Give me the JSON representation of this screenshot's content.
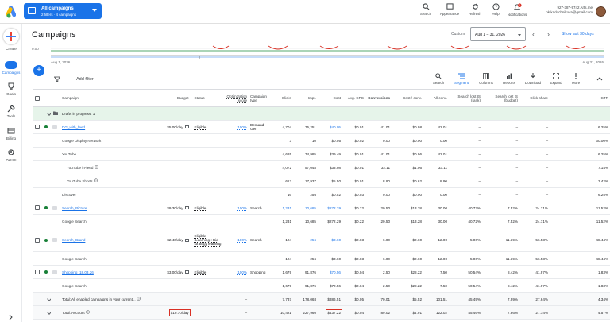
{
  "header": {
    "campaign_selector": {
      "title": "All campaigns",
      "subtitle": "2 filters · 4 campaigns"
    },
    "tools": [
      {
        "label": "Search",
        "icon": "search-icon"
      },
      {
        "label": "Appearance",
        "icon": "appearance-icon"
      },
      {
        "label": "Refresh",
        "icon": "refresh-icon"
      },
      {
        "label": "Help",
        "icon": "help-icon"
      },
      {
        "label": "Notifications",
        "icon": "bell-icon",
        "badge": "1"
      }
    ],
    "account_line1": "927-387-9742 Arts.me",
    "account_line2": "ok.kadochnikova@gmail.com"
  },
  "rail": [
    {
      "label": "Create",
      "icon": "plus-icon"
    },
    {
      "label": "Campaigns",
      "icon": "campaigns-icon"
    },
    {
      "label": "Goals",
      "icon": "trophy-icon"
    },
    {
      "label": "Tools",
      "icon": "tools-icon"
    },
    {
      "label": "Billing",
      "icon": "billing-icon"
    },
    {
      "label": "Admin",
      "icon": "admin-icon"
    }
  ],
  "page": {
    "title": "Campaigns",
    "custom_label": "Custom",
    "date_range": "Aug 1 – 31, 2026",
    "show_last": "Show last 30 days"
  },
  "chart": {
    "y_tick": "0.00",
    "x_start": "Aug 1, 2026",
    "x_end": "Aug 31, 2026",
    "marker": "‖"
  },
  "toolbar": {
    "add_filter": "Add filter",
    "items": [
      {
        "label": "Search",
        "icon": "search-icon"
      },
      {
        "label": "Segment",
        "icon": "segment-icon",
        "active": true
      },
      {
        "label": "Columns",
        "icon": "columns-icon"
      },
      {
        "label": "Reports",
        "icon": "reports-icon"
      },
      {
        "label": "Download",
        "icon": "download-icon"
      },
      {
        "label": "Expand",
        "icon": "expand-icon"
      },
      {
        "label": "More",
        "icon": "more-icon"
      }
    ]
  },
  "table": {
    "columns": [
      "Campaign",
      "Budget",
      "Status",
      "Optimization score",
      "Campaign type",
      "Clicks",
      "Impr.",
      "Cost",
      "Avg. CPC",
      "Conversions",
      "Cost / conv.",
      "All conv.",
      "Search lost IS (rank)",
      "Search lost IS (budget)",
      "Click share",
      "CTR"
    ],
    "drafts_label": "Drafts in progress: 1",
    "rows": [
      {
        "kind": "campaign",
        "name": "DG_with_feed",
        "budget": "$5.00/day",
        "status": "Eligible",
        "opt": "100%",
        "type": "Demand Gen",
        "clicks": "4,704",
        "impr": "75,251",
        "cost": "$40.05",
        "cpc": "$0.01",
        "conv": "41.01",
        "cpconv": "$0.98",
        "allconv": "42.01",
        "lostrank": "–",
        "lostbudget": "–",
        "clickshare": "–",
        "ctr": "6.25%"
      },
      {
        "kind": "sub",
        "indent": 0,
        "name": "Google Display Network",
        "clicks": "3",
        "impr": "10",
        "cost": "$0.05",
        "cpc": "$0.02",
        "conv": "0.00",
        "cpconv": "$0.00",
        "allconv": "0.00",
        "lostrank": "–",
        "lostbudget": "–",
        "clickshare": "–",
        "ctr": "30.00%"
      },
      {
        "kind": "sub",
        "indent": 0,
        "name": "YouTube",
        "clicks": "4,685",
        "impr": "74,985",
        "cost": "$39.49",
        "cpc": "$0.01",
        "conv": "41.01",
        "cpconv": "$0.96",
        "allconv": "42.01",
        "lostrank": "–",
        "lostbudget": "–",
        "clickshare": "–",
        "ctr": "6.25%"
      },
      {
        "kind": "sub",
        "indent": 1,
        "name": "YouTube in-feed",
        "help": true,
        "clicks": "4,072",
        "impr": "57,048",
        "cost": "$33.98",
        "cpc": "$0.01",
        "conv": "32.11",
        "cpconv": "$1.06",
        "allconv": "33.11",
        "lostrank": "–",
        "lostbudget": "–",
        "clickshare": "–",
        "ctr": "7.14%"
      },
      {
        "kind": "sub",
        "indent": 1,
        "name": "YouTube Shorts",
        "help": true,
        "clicks": "613",
        "impr": "17,937",
        "cost": "$5.50",
        "cpc": "$0.01",
        "conv": "8.90",
        "cpconv": "$0.62",
        "allconv": "8.90",
        "lostrank": "–",
        "lostbudget": "–",
        "clickshare": "–",
        "ctr": "3.42%"
      },
      {
        "kind": "sub",
        "indent": 0,
        "name": "Discover",
        "clicks": "16",
        "impr": "256",
        "cost": "$0.52",
        "cpc": "$0.03",
        "conv": "0.00",
        "cpconv": "$0.00",
        "allconv": "0.00",
        "lostrank": "–",
        "lostbudget": "–",
        "clickshare": "–",
        "ctr": "6.25%"
      },
      {
        "kind": "campaign",
        "name": "Search_Picture",
        "budget": "$9.30/day",
        "status": "Eligible",
        "opt": "100%",
        "type": "Search",
        "clicks": "1,231",
        "impr": "10,685",
        "cost": "$272.29",
        "cpc": "$0.22",
        "conv": "20.50",
        "cpconv": "$13.28",
        "allconv": "30.00",
        "lostrank": "40.72%",
        "lostbudget": "7.52%",
        "clickshare": "24.71%",
        "ctr": "11.52%"
      },
      {
        "kind": "sub",
        "indent": 0,
        "name": "Google Search",
        "clicks": "1,231",
        "impr": "10,685",
        "cost": "$272.29",
        "cpc": "$0.22",
        "conv": "20.50",
        "cpconv": "$13.28",
        "allconv": "30.00",
        "lostrank": "40.72%",
        "lostbudget": "7.52%",
        "clickshare": "24.71%",
        "ctr": "11.52%"
      },
      {
        "kind": "campaign",
        "name": "Search_Brand",
        "budget": "$2.40/day",
        "status": "Eligible (Learning): Bid strategy learning",
        "opt": "100%",
        "type": "Search",
        "clicks": "124",
        "impr": "256",
        "cost": "$3.60",
        "cpc": "$0.03",
        "conv": "6.00",
        "cpconv": "$0.60",
        "allconv": "12.00",
        "lostrank": "5.06%",
        "lostbudget": "11.39%",
        "clickshare": "56.53%",
        "ctr": "48.44%",
        "tall": true
      },
      {
        "kind": "sub",
        "indent": 0,
        "name": "Google Search",
        "clicks": "124",
        "impr": "256",
        "cost": "$3.60",
        "cpc": "$0.03",
        "conv": "6.00",
        "cpconv": "$0.60",
        "allconv": "12.00",
        "lostrank": "5.06%",
        "lostbudget": "11.39%",
        "clickshare": "56.53%",
        "ctr": "48.44%"
      },
      {
        "kind": "campaign",
        "name": "Shopping_18.03.26",
        "budget": "$3.00/day",
        "status": "Eligible",
        "opt": "100%",
        "type": "Shopping",
        "clicks": "1,679",
        "impr": "91,876",
        "cost": "$70.56",
        "cpc": "$0.04",
        "conv": "2.50",
        "cpconv": "$28.22",
        "allconv": "7.50",
        "lostrank": "50.54%",
        "lostbudget": "8.42%",
        "clickshare": "41.97%",
        "ctr": "1.83%"
      },
      {
        "kind": "sub",
        "indent": 0,
        "name": "Google Search",
        "clicks": "1,679",
        "impr": "91,876",
        "cost": "$70.56",
        "cpc": "$0.04",
        "conv": "2.50",
        "cpconv": "$28.22",
        "allconv": "7.50",
        "lostrank": "50.54%",
        "lostbudget": "8.42%",
        "clickshare": "41.97%",
        "ctr": "1.83%"
      },
      {
        "kind": "total",
        "name": "Total: All enabled campaigns in your current...",
        "help": true,
        "budget": "",
        "status": "",
        "opt": "–",
        "type": "",
        "clicks": "7,737",
        "impr": "178,068",
        "cost": "$386.51",
        "cpc": "$0.05",
        "conv": "70.01",
        "cpconv": "$5.52",
        "allconv": "101.51",
        "lostrank": "45.49%",
        "lostbudget": "7.99%",
        "clickshare": "27.64%",
        "ctr": "4.34%"
      },
      {
        "kind": "total",
        "name": "Total: Account",
        "help": true,
        "budget": "$19.70/day",
        "budget_highlight": true,
        "status": "",
        "opt": "–",
        "type": "",
        "clicks": "10,421",
        "impr": "227,960",
        "cost": "$437.22",
        "cost_highlight": true,
        "cpc": "$0.04",
        "conv": "89.02",
        "cpconv": "$4.91",
        "allconv": "122.02",
        "lostrank": "45.46%",
        "lostbudget": "7.86%",
        "clickshare": "27.74%",
        "ctr": "4.57%"
      }
    ]
  },
  "colors": {
    "accent": "#1a73e8",
    "drafts_bg": "#e6f4ea",
    "status_green": "#188038",
    "highlight": "#d93025"
  }
}
